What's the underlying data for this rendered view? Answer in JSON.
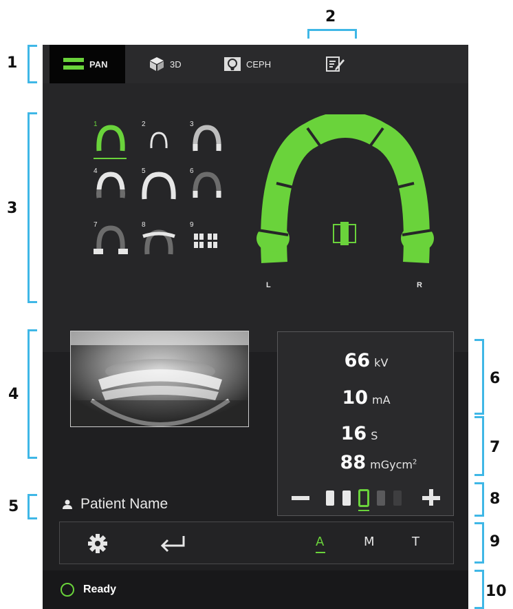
{
  "tabs": [
    {
      "label": "PAN",
      "icon": "pan-icon"
    },
    {
      "label": "3D",
      "icon": "cube-icon"
    },
    {
      "label": "CEPH",
      "icon": "ceph-icon"
    },
    {
      "label": "",
      "icon": "notes-edit-icon"
    }
  ],
  "active_tab": "PAN",
  "arch_programs": [
    "1",
    "2",
    "3",
    "4",
    "5",
    "6",
    "7",
    "8",
    "9"
  ],
  "active_program": "1",
  "arch_labels": {
    "left": "L",
    "right": "R"
  },
  "exposure": {
    "kv": {
      "value": "66",
      "unit": "kV"
    },
    "ma": {
      "value": "10",
      "unit": "mA"
    },
    "time": {
      "value": "16",
      "unit": "S"
    },
    "dose": {
      "value": "88",
      "unit": "mGycm",
      "sup": "2"
    },
    "dose_level_selected": 3,
    "dose_level_count": 5
  },
  "patient": {
    "name": "Patient Name"
  },
  "toolbar": {
    "modes": [
      "A",
      "M",
      "T"
    ],
    "active_mode": "A"
  },
  "status": {
    "text": "Ready"
  },
  "callouts": [
    "1",
    "2",
    "3",
    "4",
    "5",
    "6",
    "7",
    "8",
    "9",
    "10"
  ],
  "colors": {
    "accent": "#6ad33b",
    "bracket": "#3fb7e6",
    "panel": "#1f1f21"
  }
}
